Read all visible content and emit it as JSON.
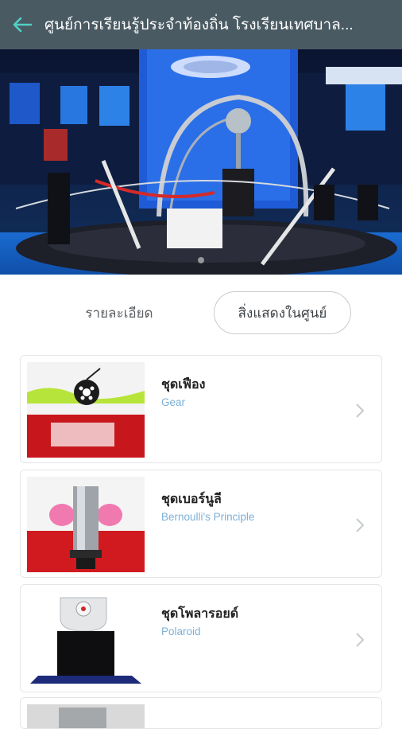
{
  "header": {
    "title": "ศูนย์การเรียนรู้ประจำท้องถิ่น โรงเรียนเทศบาล...",
    "back_icon": "arrow-left-icon",
    "background": "#4a5a63",
    "accent": "#4fd1c5"
  },
  "tabs": [
    {
      "label": "รายละเอียด",
      "active": false
    },
    {
      "label": "สิ่งแสดงในศูนย์",
      "active": true
    }
  ],
  "exhibits": [
    {
      "title": "ชุดเฟือง",
      "subtitle": "Gear"
    },
    {
      "title": "ชุดเบอร์นูลี",
      "subtitle": "Bernoulli's Principle"
    },
    {
      "title": "ชุดโพลารอยด์",
      "subtitle": "Polaroid"
    }
  ]
}
